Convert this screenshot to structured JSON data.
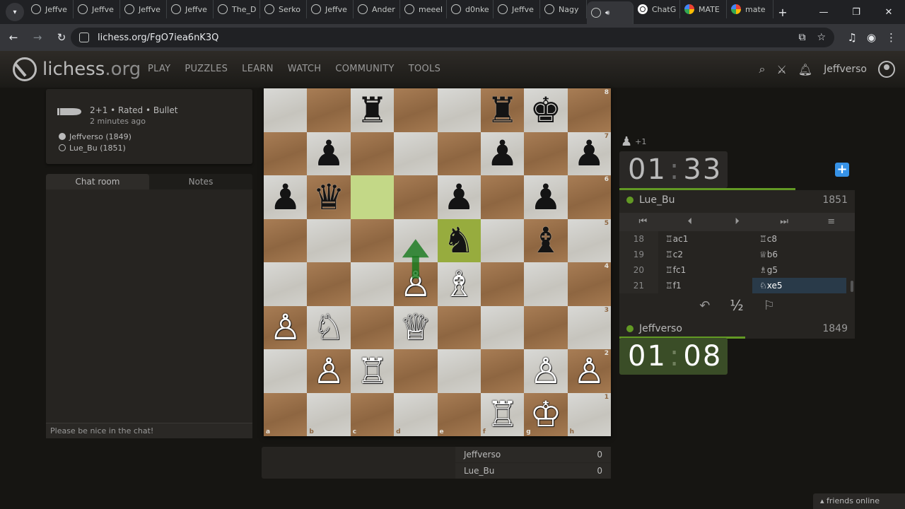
{
  "browser": {
    "tabs": [
      {
        "label": "Jeffve"
      },
      {
        "label": "Jeffve"
      },
      {
        "label": "Jeffve"
      },
      {
        "label": "Jeffve"
      },
      {
        "label": "The_D"
      },
      {
        "label": "Serko"
      },
      {
        "label": "Jeffve"
      },
      {
        "label": "Ander"
      },
      {
        "label": "meeel"
      },
      {
        "label": "d0nke"
      },
      {
        "label": "Jeffve"
      },
      {
        "label": "Nagy"
      },
      {
        "label": ""
      },
      {
        "label": "ChatG"
      },
      {
        "label": "MATE"
      },
      {
        "label": "mate"
      }
    ],
    "url": "lichess.org/FgO7iea6nK3Q"
  },
  "site": {
    "logo_main": "lichess",
    "logo_tld": ".org",
    "nav": [
      "PLAY",
      "PUZZLES",
      "LEARN",
      "WATCH",
      "COMMUNITY",
      "TOOLS"
    ],
    "username": "Jeffverso"
  },
  "game_info": {
    "mode": "2+1 • Rated • Bullet",
    "ago": "2 minutes ago",
    "white_player": "Jeffverso (1849)",
    "black_player": "Lue_Bu (1851)"
  },
  "chat": {
    "tab_chat": "Chat room",
    "tab_notes": "Notes",
    "placeholder": "Please be nice in the chat!"
  },
  "board": {
    "ranks": [
      "8",
      "7",
      "6",
      "5",
      "4",
      "3",
      "2",
      "1"
    ],
    "files": [
      "a",
      "b",
      "c",
      "d",
      "e",
      "f",
      "g",
      "h"
    ],
    "pieces": {
      "c8": "♜",
      "f8": "♜",
      "g8": "♚",
      "b7": "♟",
      "f7": "♟",
      "h7": "♟",
      "a6": "♟",
      "b6": "♛",
      "e6": "♟",
      "g6": "♟",
      "e5": "♞",
      "g5": "♝",
      "d4": "♙",
      "e4": "♗",
      "a3": "♙",
      "b3": "♘",
      "d3": "♕",
      "b2": "♙",
      "c2": "♖",
      "g2": "♙",
      "h2": "♙",
      "f1": "♖",
      "g1": "♔"
    },
    "highlights": [
      "c6",
      "e5"
    ],
    "arrow": {
      "from": "d4",
      "to": "d5",
      "color": "#15781b"
    }
  },
  "score": {
    "rows": [
      {
        "name": "Jeffverso",
        "value": "0"
      },
      {
        "name": "Lue_Bu",
        "value": "0"
      }
    ]
  },
  "right_panel": {
    "material_diff": "+1",
    "top_clock": {
      "min": "01",
      "sec": "33",
      "time_fraction": 0.81
    },
    "bottom_clock": {
      "min": "01",
      "sec": "08",
      "time_fraction": 0.58
    },
    "top_player": {
      "name": "Lue_Bu",
      "rating": "1851"
    },
    "bottom_player": {
      "name": "Jeffverso",
      "rating": "1849"
    },
    "controls": [
      "⏮",
      "⏴",
      "⏵",
      "⏭",
      "≡"
    ],
    "moves": [
      {
        "n": "18",
        "w": "♖ac1",
        "b": "♖c8"
      },
      {
        "n": "19",
        "w": "♖c2",
        "b": "♕b6"
      },
      {
        "n": "20",
        "w": "♖fc1",
        "b": "♗g5"
      },
      {
        "n": "21",
        "w": "♖f1",
        "b": "♘xe5"
      }
    ],
    "draw_symbol": "½"
  },
  "friends": "friends online",
  "colors": {
    "accent": "#629924",
    "highlight": "#97ac3e",
    "blue": "#3692e7"
  }
}
